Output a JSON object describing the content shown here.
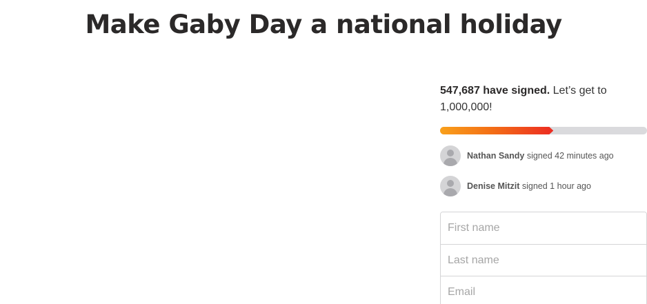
{
  "page": {
    "title": "Make Gaby Day a national holiday"
  },
  "petition": {
    "signed_count": "547,687 have signed.",
    "goal_text": " Let’s get to 1,000,000!",
    "progress_fraction": 0.5477,
    "progress_colors": [
      "#f9a01b",
      "#ec2c22"
    ],
    "track_color": "#dadadd"
  },
  "recent_signers": [
    {
      "name": "Nathan Sandy",
      "action": " signed 42 minutes ago"
    },
    {
      "name": "Denise Mitzit",
      "action": " signed 1 hour ago"
    }
  ],
  "form": {
    "first_name_placeholder": "First name",
    "last_name_placeholder": "Last name",
    "email_placeholder": "Email"
  }
}
